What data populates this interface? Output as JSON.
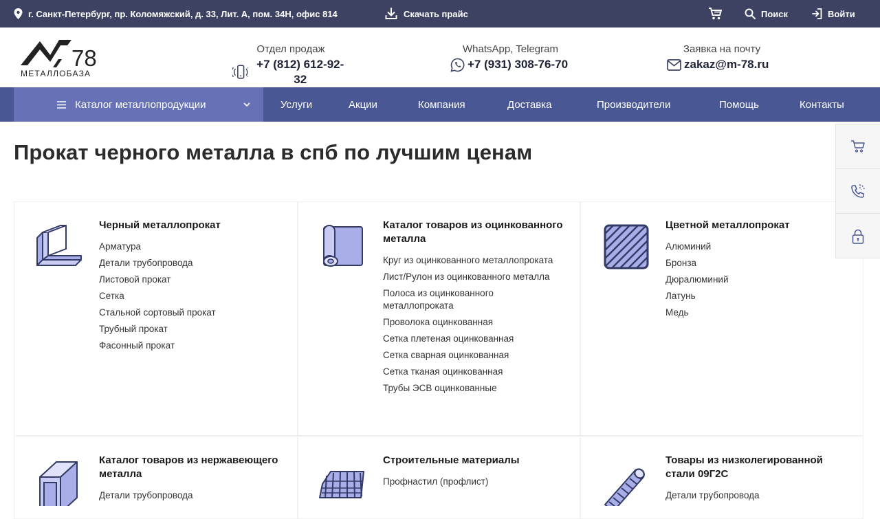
{
  "topbar": {
    "address": "г. Санкт-Петербург, пр. Коломяжский, д. 33, Лит. А, пом. 34Н, офис 814",
    "download": "Скачать прайс",
    "search": "Поиск",
    "login": "Войти"
  },
  "logo": {
    "number": "78",
    "name": "МЕТАЛЛОБАЗА"
  },
  "contacts": [
    {
      "label": "Отдел продаж",
      "value": "+7 (812) 612-92-32",
      "icon": "phone-icon"
    },
    {
      "label": "WhatsApp, Telegram",
      "value": "+7 (931) 308-76-70",
      "icon": "whatsapp-icon"
    },
    {
      "label": "Заявка на почту",
      "value": "zakaz@m-78.ru",
      "icon": "mail-icon"
    }
  ],
  "nav": {
    "catalog": "Каталог металлопродукции",
    "links": [
      "Услуги",
      "Акции",
      "Компания",
      "Доставка",
      "Производители",
      "Помощь",
      "Контакты"
    ]
  },
  "page_title": "Прокат черного металла в спб по лучшим ценам",
  "cards": [
    {
      "title": "Черный металлопрокат",
      "items": [
        "Арматура",
        "Детали трубопровода",
        "Листовой прокат",
        "Сетка",
        "Стальной сортовый прокат",
        "Трубный прокат",
        "Фасонный прокат"
      ]
    },
    {
      "title": "Каталог товаров из оцинкованного металла",
      "items": [
        "Круг из оцинкованного металлопроката",
        "Лист/Рулон из оцинкованного металла",
        "Полоса из оцинкованного металлопроката",
        "Проволока оцинкованная",
        "Сетка плетеная оцинкованная",
        "Сетка сварная оцинкованная",
        "Сетка тканая оцинкованная",
        "Трубы ЭСВ оцинкованные"
      ]
    },
    {
      "title": "Цветной металлопрокат",
      "items": [
        "Алюминий",
        "Бронза",
        "Дюралюминий",
        "Латунь",
        "Медь"
      ]
    },
    {
      "title": "Каталог товаров из нержавеющего металла",
      "items": [
        "Детали трубопровода"
      ]
    },
    {
      "title": "Строительные материалы",
      "items": [
        "Профнастил (профлист)"
      ]
    },
    {
      "title": "Товары из низколегированной стали 09Г2С",
      "items": [
        "Детали трубопровода"
      ]
    }
  ],
  "colors": {
    "topbar": "#3d4263",
    "nav": "#4a5795",
    "nav_active": "#6672b5",
    "icon_fill": "#a9aee8",
    "icon_stroke": "#333a66"
  }
}
